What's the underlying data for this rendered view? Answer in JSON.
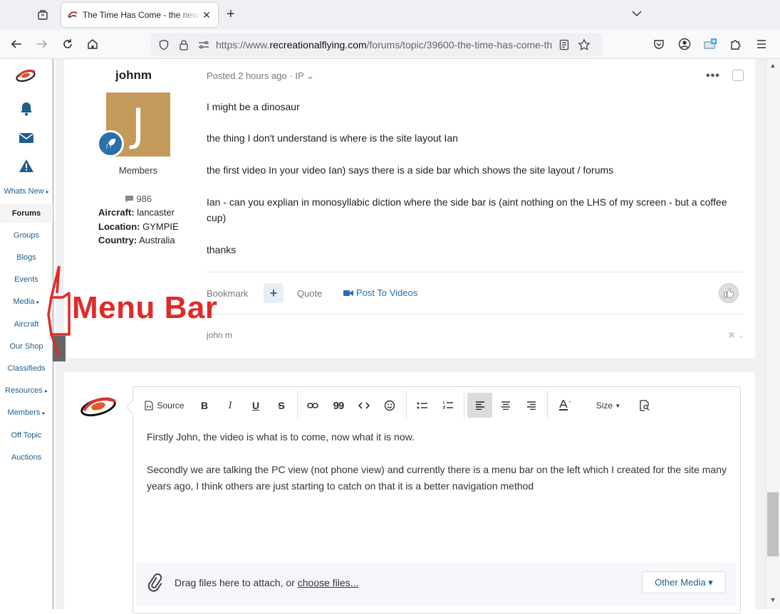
{
  "browser": {
    "tab_title": "The Time Has Come - the new ar",
    "url_prefix": "https://www.",
    "url_domain": "recreationalflying.com",
    "url_path": "/forums/topic/39600-the-time-has-come-th"
  },
  "sidebar": {
    "items": [
      {
        "label": "Whats New",
        "has_submenu": true
      },
      {
        "label": "Forums",
        "has_submenu": false,
        "active": true
      },
      {
        "label": "Groups",
        "has_submenu": false
      },
      {
        "label": "Blogs",
        "has_submenu": false
      },
      {
        "label": "Events",
        "has_submenu": false
      },
      {
        "label": "Media",
        "has_submenu": true
      },
      {
        "label": "Aircraft",
        "has_submenu": false
      },
      {
        "label": "Our Shop",
        "has_submenu": false
      },
      {
        "label": "Classifieds",
        "has_submenu": false
      },
      {
        "label": "Resources",
        "has_submenu": true
      },
      {
        "label": "Members",
        "has_submenu": true
      },
      {
        "label": "Off Topic",
        "has_submenu": false
      },
      {
        "label": "Auctions",
        "has_submenu": false
      }
    ],
    "submenu_marker": "▸"
  },
  "post": {
    "author": "johnm",
    "avatar_letter": "J",
    "group": "Members",
    "post_count": "986",
    "fields": [
      {
        "label": "Aircraft:",
        "value": "lancaster"
      },
      {
        "label": "Location:",
        "value": "GYMPIE"
      },
      {
        "label": "Country:",
        "value": "Australia"
      }
    ],
    "posted_prefix": "Posted",
    "posted_time": "2 hours ago",
    "posted_suffix": "· IP ⌄",
    "paragraphs": [
      "I might be a dinosaur",
      "the thing I don't understand is where is the site layout Ian",
      "the first video In your video Ian) says there is a side bar which shows the site layout / forums",
      "Ian - can you explian in monosyllabic diction where the side bar is (aint nothing on the LHS of my screen - but a coffee cup)",
      "thanks"
    ],
    "actions": {
      "bookmark": "Bookmark",
      "plus": "+",
      "quote": "Quote",
      "post_to_videos": "Post To Videos"
    },
    "signature": "john m",
    "signature_close": "✖ ⌄"
  },
  "editor": {
    "toolbar": {
      "source": "Source",
      "bold": "B",
      "italic": "I",
      "underline": "U",
      "strike": "S",
      "quote": "99",
      "size": "Size"
    },
    "paragraphs": [
      "Firstly John, the video is what is to come, now what it is now.",
      "Secondly we are talking the PC view (not phone view) and currently there is a menu bar on the left which I created for the site many years ago, I think others are just starting to catch on that it is a better navigation method"
    ],
    "attach_text": "Drag files here to attach, or ",
    "attach_link": "choose files...",
    "other_media": "Other Media ▾"
  },
  "annotation": {
    "label": "Menu Bar",
    "color": "#e02a2a"
  }
}
